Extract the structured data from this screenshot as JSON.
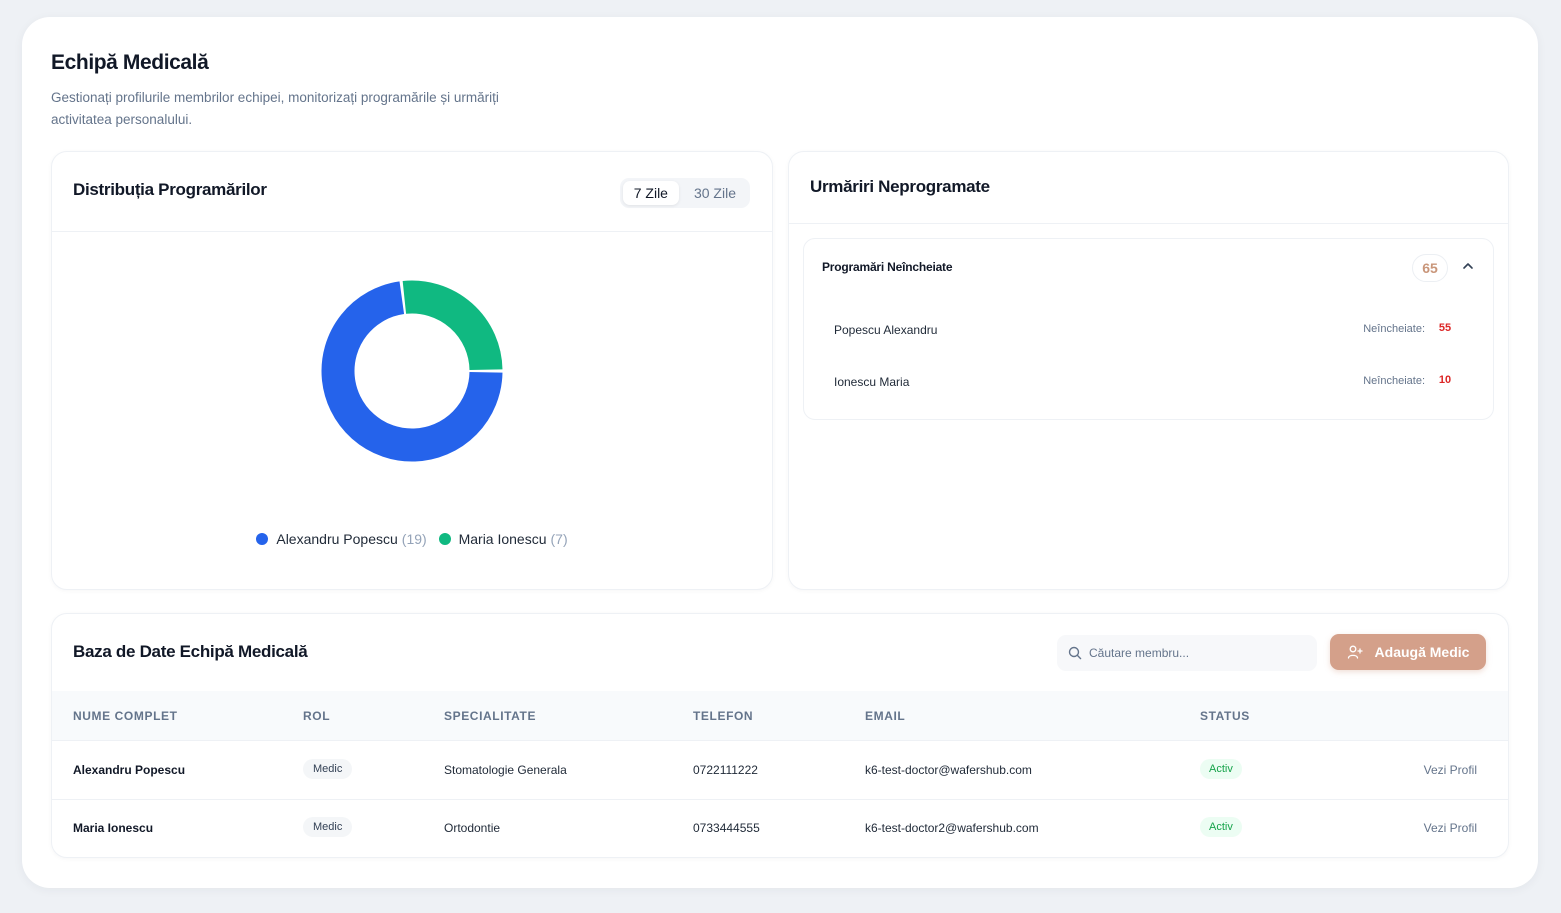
{
  "header": {
    "title": "Echipă Medicală",
    "description": "Gestionați profilurile membrilor echipei, monitorizați programările și urmăriți activitatea personalului."
  },
  "distribution": {
    "title": "Distribuția Programărilor",
    "tabs": [
      "7 Zile",
      "30 Zile"
    ],
    "active_tab": "7 Zile",
    "chart_data": {
      "type": "pie",
      "categories": [
        "Alexandru Popescu",
        "Maria Ionescu"
      ],
      "values": [
        19,
        7
      ],
      "colors": [
        "#2563eb",
        "#10b981"
      ]
    },
    "legend": [
      {
        "name": "Alexandru Popescu",
        "count": "(19)",
        "color": "#2563eb"
      },
      {
        "name": "Maria Ionescu",
        "count": "(7)",
        "color": "#10b981"
      }
    ]
  },
  "followups": {
    "title": "Urmăriri Neprogramate",
    "group": {
      "title": "Programări Neîncheiate",
      "count": "65",
      "icon": "chevron-up-icon",
      "items": [
        {
          "name": "Popescu Alexandru",
          "label": "Neîncheiate:",
          "value": "55"
        },
        {
          "name": "Ionescu Maria",
          "label": "Neîncheiate:",
          "value": "10"
        }
      ]
    }
  },
  "team_table": {
    "title": "Baza de Date Echipă Medicală",
    "search_placeholder": "Căutare membru...",
    "add_button": "Adaugă Medic",
    "columns": [
      "NUME COMPLET",
      "ROL",
      "SPECIALITATE",
      "TELEFON",
      "EMAIL",
      "STATUS"
    ],
    "rows": [
      {
        "name": "Alexandru Popescu",
        "role": "Medic",
        "specialty": "Stomatologie Generala",
        "phone": "0722111222",
        "email": "k6-test-doctor@wafershub.com",
        "status": "Activ",
        "action": "Vezi Profil"
      },
      {
        "name": "Maria Ionescu",
        "role": "Medic",
        "specialty": "Ortodontie",
        "phone": "0733444555",
        "email": "k6-test-doctor2@wafershub.com",
        "status": "Activ",
        "action": "Vezi Profil"
      }
    ]
  },
  "colors": {
    "accent": "#d4a08a",
    "blue": "#2563eb",
    "green": "#10b981",
    "danger": "#dc2626"
  }
}
